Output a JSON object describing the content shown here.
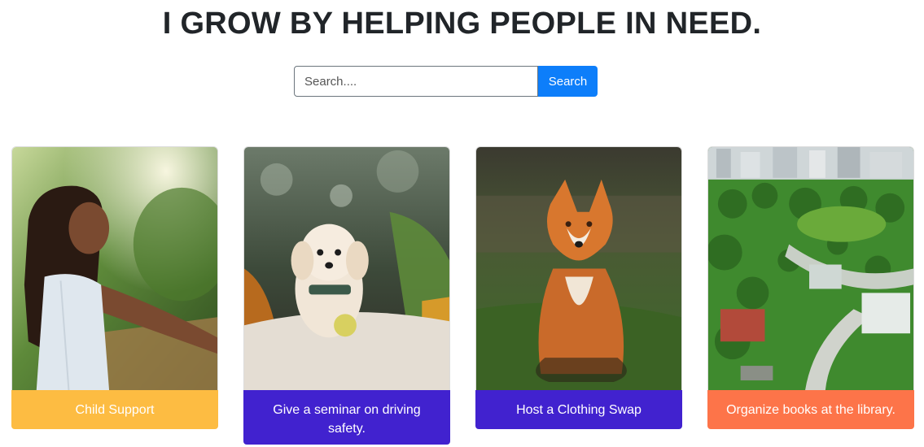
{
  "page": {
    "title": "I GROW BY HELPING PEOPLE IN NEED."
  },
  "search": {
    "placeholder": "Search....",
    "button_label": "Search",
    "button_color": "#0d7efa"
  },
  "cards": [
    {
      "label": "Child Support",
      "color": "#fdbc42",
      "image": "girl-photo"
    },
    {
      "label": "Give a seminar on driving safety.",
      "color": "#4122cf",
      "image": "dog-photo"
    },
    {
      "label": "Host a Clothing Swap",
      "color": "#4122cf",
      "image": "fox-photo"
    },
    {
      "label": "Organize books at the library.",
      "color": "#fd7449",
      "image": "park-photo"
    }
  ]
}
